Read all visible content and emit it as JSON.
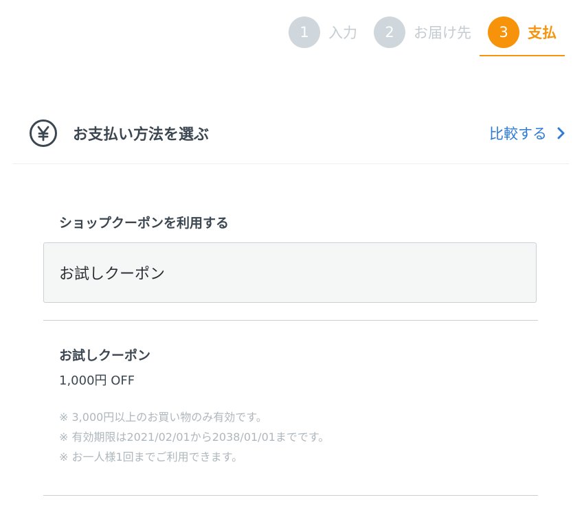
{
  "steps": [
    {
      "number": "1",
      "label": "入力",
      "state": "inactive"
    },
    {
      "number": "2",
      "label": "お届け先",
      "state": "inactive"
    },
    {
      "number": "3",
      "label": "支払",
      "state": "active"
    }
  ],
  "header": {
    "icon": "yen-circle-icon",
    "title": "お支払い方法を選ぶ",
    "compare_label": "比較する",
    "compare_icon": "chevron-right-icon"
  },
  "coupon": {
    "label": "ショップクーポンを利用する",
    "selected": "お試しクーポン",
    "detail": {
      "name": "お試しクーポン",
      "discount": "1,000円 OFF",
      "notes": [
        "※ 3,000円以上のお買い物のみ有効です。",
        "※ 有効期限は2021/02/01から2038/01/01までです。",
        "※ お一人様1回までご利用できます。"
      ]
    }
  },
  "colors": {
    "accent": "#f7930a",
    "link": "#2e7ad8",
    "inactive_step": "#cfd7dc",
    "text": "#3b4650",
    "muted": "#aeb7bd"
  }
}
